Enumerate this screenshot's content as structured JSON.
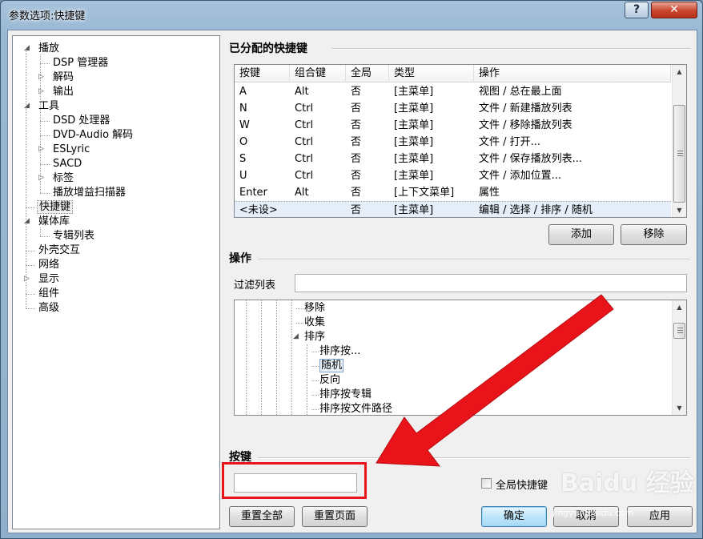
{
  "window": {
    "title": "参数选项:快捷键",
    "help_label": "?",
    "close_label": "✕"
  },
  "tree": {
    "items": [
      {
        "label": "播放",
        "level": 0,
        "expander": "expanded"
      },
      {
        "label": "DSP 管理器",
        "level": 1,
        "expander": "none"
      },
      {
        "label": "解码",
        "level": 1,
        "expander": "collapsed"
      },
      {
        "label": "输出",
        "level": 1,
        "expander": "collapsed"
      },
      {
        "label": "工具",
        "level": 0,
        "expander": "expanded"
      },
      {
        "label": "DSD 处理器",
        "level": 1,
        "expander": "none"
      },
      {
        "label": "DVD-Audio 解码",
        "level": 1,
        "expander": "none"
      },
      {
        "label": "ESLyric",
        "level": 1,
        "expander": "collapsed"
      },
      {
        "label": "SACD",
        "level": 1,
        "expander": "none"
      },
      {
        "label": "标签",
        "level": 1,
        "expander": "collapsed"
      },
      {
        "label": "播放增益扫描器",
        "level": 1,
        "expander": "none"
      },
      {
        "label": "快捷键",
        "level": 0,
        "expander": "none",
        "selected": true
      },
      {
        "label": "媒体库",
        "level": 0,
        "expander": "expanded"
      },
      {
        "label": "专辑列表",
        "level": 1,
        "expander": "none"
      },
      {
        "label": "外壳交互",
        "level": 0,
        "expander": "none"
      },
      {
        "label": "网络",
        "level": 0,
        "expander": "none"
      },
      {
        "label": "显示",
        "level": 0,
        "expander": "collapsed"
      },
      {
        "label": "组件",
        "level": 0,
        "expander": "none"
      },
      {
        "label": "高级",
        "level": 0,
        "expander": "none"
      }
    ]
  },
  "assigned": {
    "title": "已分配的快捷键",
    "columns": [
      "按键",
      "组合键",
      "全局",
      "类型",
      "操作"
    ],
    "rows": [
      [
        "A",
        "Alt",
        "否",
        "[主菜单]",
        "视图 / 总在最上面"
      ],
      [
        "N",
        "Ctrl",
        "否",
        "[主菜单]",
        "文件 / 新建播放列表"
      ],
      [
        "W",
        "Ctrl",
        "否",
        "[主菜单]",
        "文件 / 移除播放列表"
      ],
      [
        "O",
        "Ctrl",
        "否",
        "[主菜单]",
        "文件 / 打开..."
      ],
      [
        "S",
        "Ctrl",
        "否",
        "[主菜单]",
        "文件 / 保存播放列表..."
      ],
      [
        "U",
        "Ctrl",
        "否",
        "[主菜单]",
        "文件 / 添加位置..."
      ],
      [
        "Enter",
        "Alt",
        "否",
        "[上下文菜单]",
        "属性"
      ],
      [
        "<未设>",
        "",
        "否",
        "[主菜单]",
        "编辑 / 选择 / 排序 / 随机"
      ]
    ],
    "selected_row": 7,
    "add_label": "添加",
    "remove_label": "移除"
  },
  "operations": {
    "title": "操作",
    "filter_label": "过滤列表",
    "filter_value": "",
    "items": [
      {
        "label": "移除",
        "level": 3
      },
      {
        "label": "收集",
        "level": 3
      },
      {
        "label": "排序",
        "level": 3,
        "expander": "expanded"
      },
      {
        "label": "排序按...",
        "level": 4
      },
      {
        "label": "随机",
        "level": 4,
        "selected": true
      },
      {
        "label": "反向",
        "level": 4
      },
      {
        "label": "排序按专辑",
        "level": 4
      },
      {
        "label": "排序按文件路径",
        "level": 4
      }
    ]
  },
  "key": {
    "title": "按键",
    "value": "",
    "global_label": "全局快捷键",
    "global_checked": false
  },
  "footer": {
    "reset_all": "重置全部",
    "reset_page": "重置页面",
    "ok": "确定",
    "cancel": "取消",
    "apply": "应用"
  },
  "watermark": {
    "logo": "Baidu 经验",
    "url": "jingyan.baidu.com"
  },
  "colors": {
    "annotation_red": "#e8141a",
    "selection_blue": "#e5eef9"
  }
}
